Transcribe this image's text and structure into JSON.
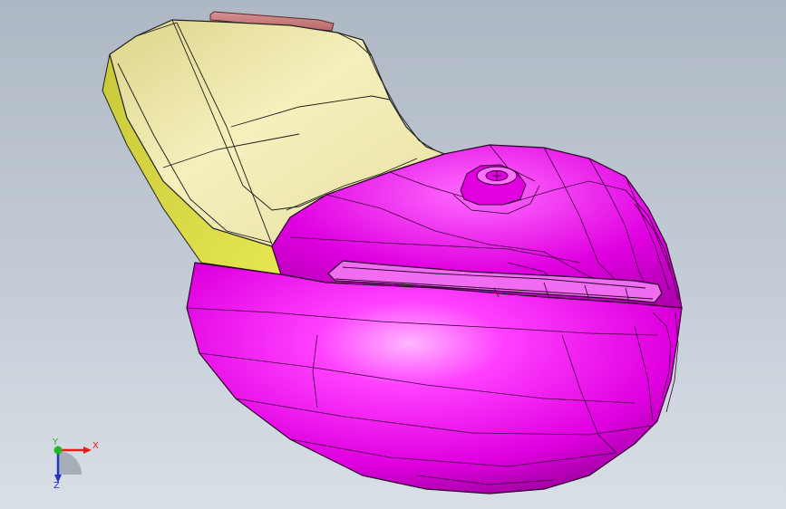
{
  "viewport": {
    "background_top": "#aeb8c4",
    "background_bottom": "#d9dfe6"
  },
  "model": {
    "parts": [
      {
        "name": "lower-housing",
        "color": "#e600e6"
      },
      {
        "name": "upper-panel",
        "color": "#efe9a6"
      },
      {
        "name": "side-rim",
        "color": "#d8d84a"
      },
      {
        "name": "top-cap",
        "color": "#c98080"
      }
    ]
  },
  "triad": {
    "x_label": "X",
    "y_label": "Y",
    "z_label": "Z",
    "x_color": "#e0201a",
    "y_color": "#22b822",
    "z_color": "#2233cc"
  }
}
